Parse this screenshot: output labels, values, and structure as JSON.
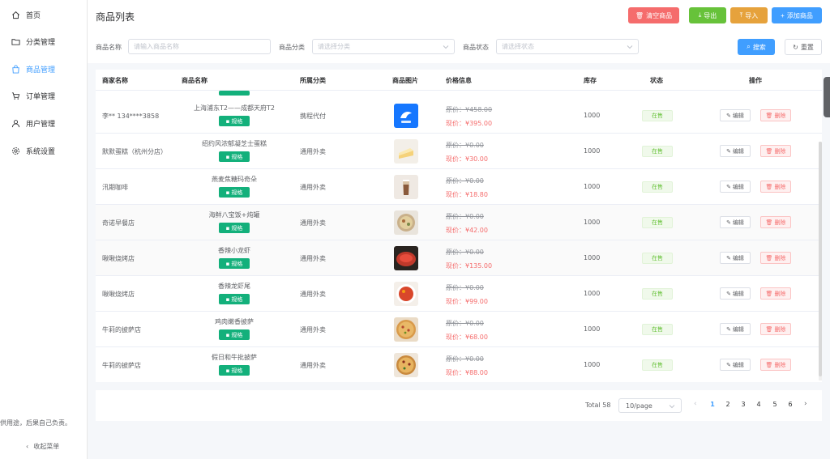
{
  "sidebar": {
    "items": [
      {
        "label": "首页",
        "icon": "home-icon"
      },
      {
        "label": "分类管理",
        "icon": "folder-icon"
      },
      {
        "label": "商品管理",
        "icon": "bag-icon",
        "active": true
      },
      {
        "label": "订单管理",
        "icon": "cart-icon"
      },
      {
        "label": "用户管理",
        "icon": "user-icon"
      },
      {
        "label": "系统设置",
        "icon": "gear-icon"
      }
    ],
    "note": "供用途，后果自己负责。",
    "collapse_label": "收起菜单"
  },
  "header": {
    "title": "商品列表",
    "clear_label": "清空商品",
    "export_label": "导出",
    "import_label": "导入",
    "add_label": "添加商品"
  },
  "filters": {
    "name_label": "商品名称",
    "name_placeholder": "请输入商品名称",
    "category_label": "商品分类",
    "category_placeholder": "请选择分类",
    "status_label": "商品状态",
    "status_placeholder": "请选择状态",
    "search_label": "搜索",
    "reset_label": "重置"
  },
  "table": {
    "headers": {
      "merchant": "商家名称",
      "name": "商品名称",
      "category": "所属分类",
      "image": "商品图片",
      "price": "价格信息",
      "stock": "库存",
      "status": "状态",
      "actions": "操作"
    },
    "spec_label": "规格",
    "edit_label": "编辑",
    "delete_label": "删除",
    "rows": [
      {
        "merchant": "李** 134****3858",
        "name": "上海浦东T2——成都天府T2",
        "category": "携程代付",
        "orig": "原价：¥458.00",
        "now": "现价：¥395.00",
        "stock": "1000",
        "status": "在售",
        "img": "ctrip"
      },
      {
        "merchant": "默默蛋糕（杭州分店）",
        "name": "绍约风浓郁凝芝士蛋糕",
        "category": "通用外卖",
        "orig": "原价：¥0.00",
        "now": "现价：¥30.00",
        "stock": "1000",
        "status": "在售",
        "img": "cake"
      },
      {
        "merchant": "汛期咖啡",
        "name": "燕麦焦糖玛奇朵",
        "category": "通用外卖",
        "orig": "原价：¥0.00",
        "now": "现价：¥18.80",
        "stock": "1000",
        "status": "在售",
        "img": "coffee"
      },
      {
        "merchant": "奇诺早餐店",
        "name": "海鲜八宝饭+炖罐",
        "category": "通用外卖",
        "orig": "原价：¥0.00",
        "now": "现价：¥42.00",
        "stock": "1000",
        "status": "在售",
        "img": "rice"
      },
      {
        "merchant": "啾啾烧烤店",
        "name": "香辣小龙虾",
        "category": "通用外卖",
        "orig": "原价：¥0.00",
        "now": "现价：¥135.00",
        "stock": "1000",
        "status": "在售",
        "img": "crayfish"
      },
      {
        "merchant": "啾啾烧烤店",
        "name": "香辣龙虾尾",
        "category": "通用外卖",
        "orig": "原价：¥0.00",
        "now": "现价：¥99.00",
        "stock": "1000",
        "status": "在售",
        "img": "lobster"
      },
      {
        "merchant": "牛莉的披萨店",
        "name": "鸡肉嫩香披萨",
        "category": "通用外卖",
        "orig": "原价：¥0.00",
        "now": "现价：¥68.00",
        "stock": "1000",
        "status": "在售",
        "img": "pizza"
      },
      {
        "merchant": "牛莉的披萨店",
        "name": "假日和牛批披萨",
        "category": "通用外卖",
        "orig": "原价：¥0.00",
        "now": "现价：¥88.00",
        "stock": "1000",
        "status": "在售",
        "img": "pizza2"
      }
    ]
  },
  "pagination": {
    "total": "Total 58",
    "page_size": "10/page",
    "pages": [
      "1",
      "2",
      "3",
      "4",
      "5",
      "6"
    ],
    "current": "1"
  },
  "colors": {
    "primary": "#409eff",
    "danger": "#f56c6c",
    "success": "#67c23a",
    "warning": "#e6a23c",
    "spec": "#13b07b"
  }
}
